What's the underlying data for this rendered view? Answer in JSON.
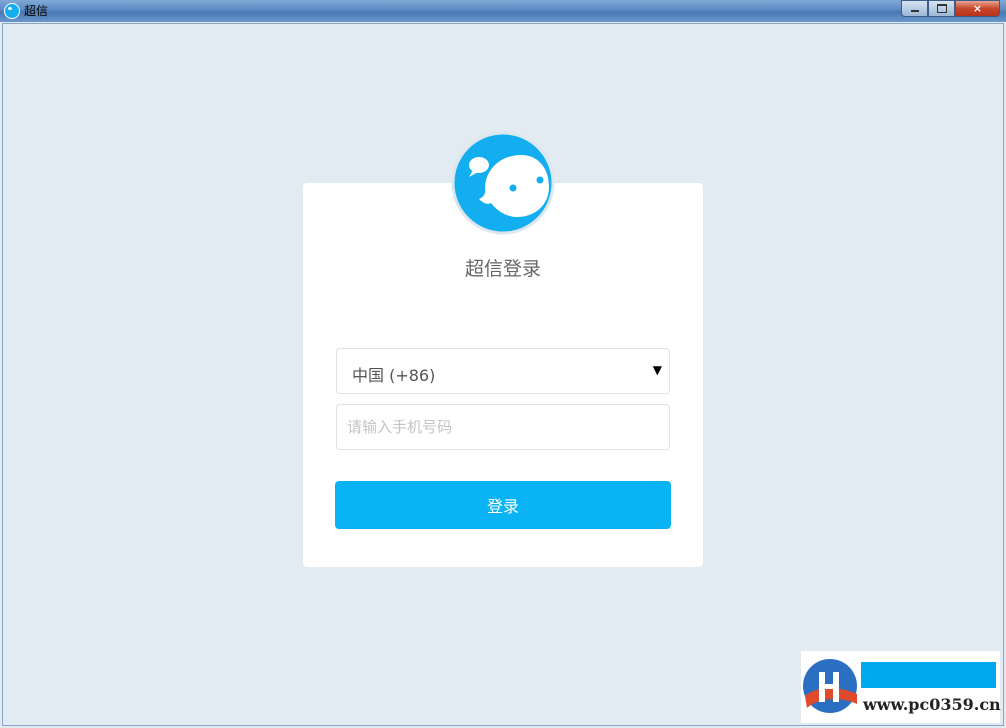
{
  "window": {
    "title": "超信",
    "minimize_label": "",
    "maximize_label": "",
    "close_label": "×"
  },
  "login": {
    "title": "超信登录",
    "country_select": "中国 (+86)",
    "country_arrow": "▼",
    "phone_placeholder": "请输入手机号码",
    "phone_value": "",
    "submit_label": "登录"
  },
  "watermark": {
    "url": "www.pc0359.cn"
  },
  "colors": {
    "background": "#e2ebf1",
    "accent": "#09b3f4",
    "logo_blue": "#13aef0"
  },
  "icons": [
    "app-icon",
    "chat-mascot-logo",
    "dropdown-arrow-icon",
    "watermark-logo"
  ]
}
